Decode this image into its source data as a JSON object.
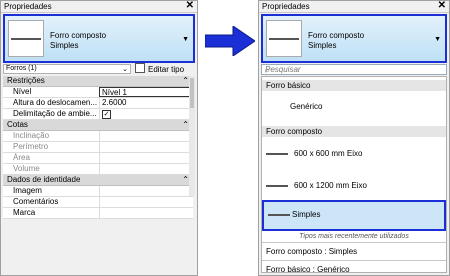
{
  "left_panel": {
    "title": "Propriedades",
    "close": "✕",
    "type_selector": {
      "family": "Forro composto",
      "type": "Simples"
    },
    "filter": {
      "label": "Forros (1)",
      "chevron": "⌄"
    },
    "edit_type": "Editar tipo",
    "sections": [
      {
        "name": "Restrições",
        "rows": [
          {
            "name": "Nível",
            "value": "Nível 1"
          },
          {
            "name": "Altura do deslocamen...",
            "value": "2.6000"
          },
          {
            "name": "Delimitação de ambie...",
            "value": "✓"
          }
        ]
      },
      {
        "name": "Cotas",
        "rows": [
          {
            "name": "Inclinação",
            "value": ""
          },
          {
            "name": "Perímetro",
            "value": ""
          },
          {
            "name": "Área",
            "value": ""
          },
          {
            "name": "Volume",
            "value": ""
          }
        ]
      },
      {
        "name": "Dados de identidade",
        "rows": [
          {
            "name": "Imagem",
            "value": ""
          },
          {
            "name": "Comentários",
            "value": ""
          },
          {
            "name": "Marca",
            "value": ""
          }
        ]
      }
    ],
    "collapse_glyph": "⌃"
  },
  "right_panel": {
    "title": "Propriedades",
    "close": "✕",
    "type_selector": {
      "family": "Forro composto",
      "type": "Simples"
    },
    "search_placeholder": "Pesquisar",
    "groups": [
      {
        "header": "Forro básico",
        "items": [
          "Genérico"
        ]
      },
      {
        "header": "Forro composto",
        "items": [
          "600 x 600 mm Eixo",
          "600 x 1200 mm Eixo",
          "Simples"
        ]
      }
    ],
    "recent_label": "Tipos mais recentemente utilizados",
    "recent_items": [
      "Forro composto : Simples",
      "Forro básico : Genérico"
    ],
    "selected": "Simples"
  },
  "colors": {
    "accent": "#1a2fd6",
    "selection": "#cce6f8"
  }
}
